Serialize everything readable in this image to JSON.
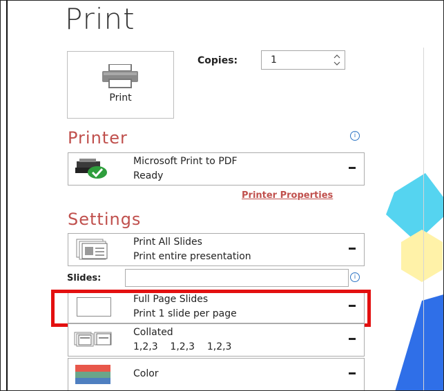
{
  "title": "Print",
  "print_button": {
    "label": "Print",
    "icon": "printer-icon"
  },
  "copies": {
    "label": "Copies:",
    "value": "1"
  },
  "printer": {
    "heading": "Printer",
    "name": "Microsoft Print to PDF",
    "status": "Ready",
    "properties_link": "Printer Properties"
  },
  "settings": {
    "heading": "Settings",
    "range": {
      "title": "Print All Slides",
      "subtitle": "Print entire presentation"
    },
    "slides_label": "Slides:",
    "slides_value": "",
    "layout": {
      "title": "Full Page Slides",
      "subtitle": "Print 1 slide per page"
    },
    "collation": {
      "title": "Collated",
      "subtitle": "1,2,3    1,2,3    1,2,3"
    },
    "color": {
      "title": "Color"
    }
  },
  "colors": {
    "section_heading": "#c0504d",
    "highlight_border": "#e31010",
    "status_green": "#2e9e3c",
    "info_blue": "#2d74c4",
    "deco_cyan": "#55d4f0",
    "deco_yellow": "#fff2a8",
    "deco_blue": "#2f6fe8"
  }
}
